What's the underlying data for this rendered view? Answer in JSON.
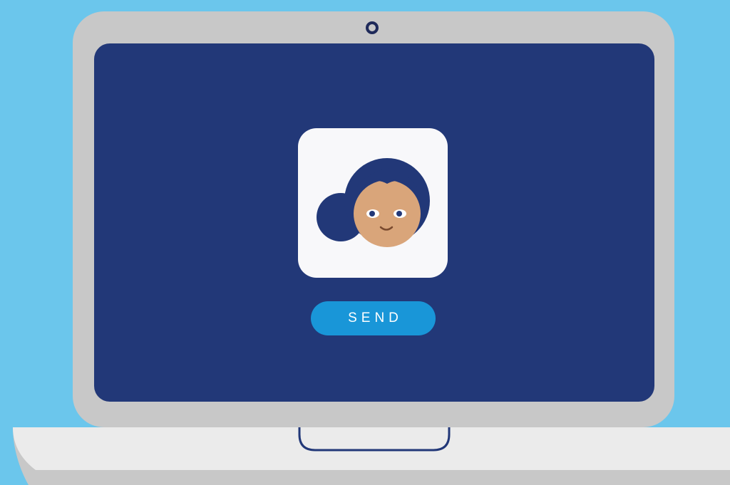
{
  "screen": {
    "avatar_icon": "user-avatar-icon",
    "send_button": {
      "label": "SEND"
    }
  },
  "colors": {
    "background": "#6bc6ec",
    "lid": "#c8c8c8",
    "screen": "#223878",
    "button": "#1996d8",
    "tile": "#f8f8fa",
    "hair": "#223878",
    "skin": "#d9a57a",
    "base": "#ebebeb",
    "base_shadow": "#c8c8c8"
  }
}
